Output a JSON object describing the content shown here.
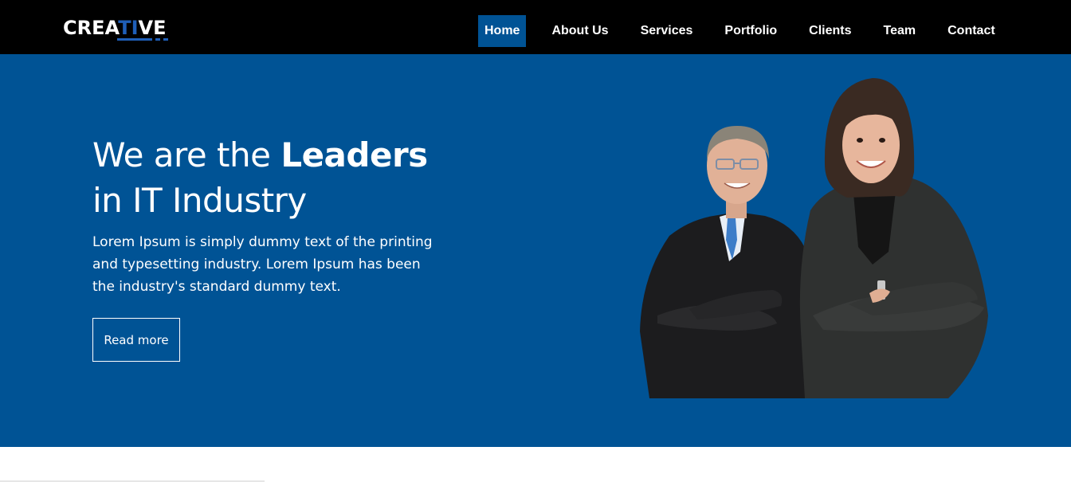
{
  "brand": {
    "logo_prefix": "CREA",
    "logo_accent": "TI",
    "logo_suffix": "VE",
    "accent_color": "#1f5fb8"
  },
  "nav": {
    "items": [
      {
        "label": "Home",
        "active": true
      },
      {
        "label": "About Us",
        "active": false
      },
      {
        "label": "Services",
        "active": false
      },
      {
        "label": "Portfolio",
        "active": false
      },
      {
        "label": "Clients",
        "active": false
      },
      {
        "label": "Team",
        "active": false
      },
      {
        "label": "Contact",
        "active": false
      }
    ],
    "active_color": "#005395"
  },
  "hero": {
    "title_prefix": "We are the ",
    "title_bold": "Leaders",
    "title_suffix": "in IT Industry",
    "description": "Lorem Ipsum is simply dummy text of the printing and typesetting industry. Lorem Ipsum has been the industry's standard dummy text.",
    "button_label": "Read more",
    "background_color": "#005395"
  }
}
